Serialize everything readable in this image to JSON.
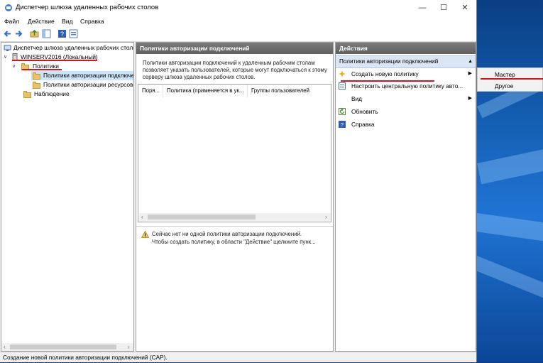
{
  "window": {
    "title": "Диспетчер шлюза удаленных рабочих столов",
    "minimize_glyph": "—",
    "maximize_glyph": "☐",
    "close_glyph": "✕"
  },
  "menu": [
    "Файл",
    "Действие",
    "Вид",
    "Справка"
  ],
  "toolbar": {
    "icons": [
      "back-arrow-icon",
      "forward-arrow-icon",
      "up-folder-icon",
      "show-hide-tree-icon",
      "help-icon",
      "properties-icon"
    ]
  },
  "tree": {
    "root": "Диспетчер шлюза удаленных рабочих столов",
    "server": "WINSERV2016 (Локальный)",
    "policies": "Политики",
    "cap": "Политики авторизации подключений",
    "rap": "Политики авторизации ресурсов",
    "monitoring": "Наблюдение"
  },
  "center": {
    "header": "Политики авторизации подключений",
    "description": "Политики авторизации подключений к удаленным рабочим столам позволяет указать пользователей, которые могут подключаться к этому серверу шлюза удаленных рабочих столов.",
    "columns": [
      "Поря...",
      "Политика (применяется в ук...",
      "Группы пользователей"
    ],
    "warning_line1": "Сейчас нет ни одной политики авторизации подключений.",
    "warning_line2": "Чтобы создать политику, в области \"Действие\" щелкните пунк..."
  },
  "actions": {
    "header": "Действия",
    "section": "Политики авторизации подключений",
    "items": [
      {
        "label": "Создать новую политику",
        "icon": "new-policy-icon",
        "submenu": true
      },
      {
        "label": "Настроить центральную политику авто...",
        "icon": "central-policy-icon",
        "submenu": false
      },
      {
        "label": "Вид",
        "icon": "",
        "submenu": true
      },
      {
        "label": "Обновить",
        "icon": "refresh-icon",
        "submenu": false
      },
      {
        "label": "Справка",
        "icon": "help-icon",
        "submenu": false
      }
    ]
  },
  "submenu": [
    "Мастер",
    "Другое"
  ],
  "status": "Создание новой политики авторизации подключений (CAP).",
  "colors": {
    "accent_underline": "#d9131e",
    "section_bg": "#dbe6f4",
    "header_gray": "#6d6d6d"
  }
}
